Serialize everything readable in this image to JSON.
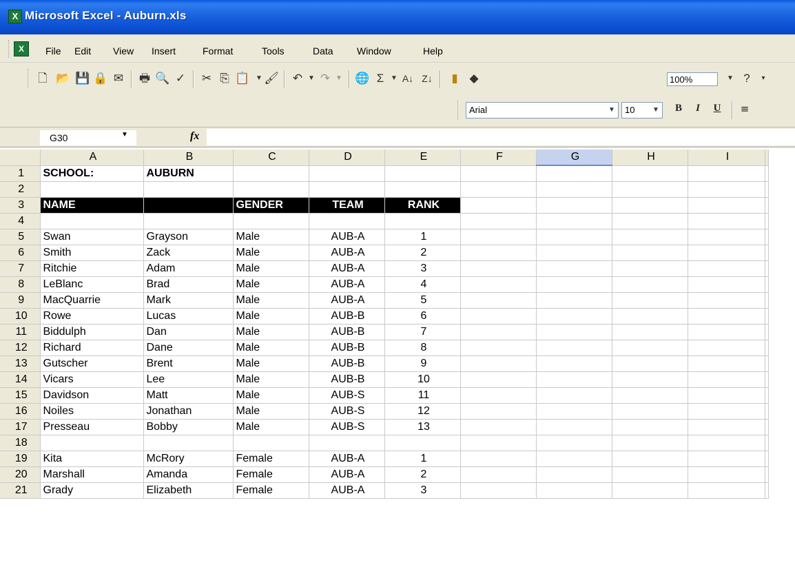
{
  "window": {
    "title": "Microsoft Excel - Auburn.xls",
    "app_icon": "excel-icon"
  },
  "menu": [
    "File",
    "Edit",
    "View",
    "Insert",
    "Format",
    "Tools",
    "Data",
    "Window",
    "Help"
  ],
  "toolbar": {
    "zoom": "100%",
    "font_name": "Arial",
    "font_size": "10",
    "bold": "B",
    "italic": "I",
    "underline": "U"
  },
  "formula_bar": {
    "name_box": "G30",
    "fx_label": "fx",
    "formula": ""
  },
  "sheet": {
    "columns": [
      "A",
      "B",
      "C",
      "D",
      "E",
      "F",
      "G",
      "H",
      "I"
    ],
    "selected_column": "G",
    "rows": [
      {
        "n": "1",
        "cells": [
          "SCHOOL:",
          "AUBURN",
          "",
          "",
          ""
        ]
      },
      {
        "n": "2",
        "cells": [
          "",
          "",
          "",
          "",
          ""
        ]
      },
      {
        "n": "3",
        "cells": [
          "NAME",
          "",
          "GENDER",
          "TEAM",
          "RANK"
        ]
      },
      {
        "n": "4",
        "cells": [
          "",
          "",
          "",
          "",
          ""
        ]
      },
      {
        "n": "5",
        "cells": [
          "Swan",
          "Grayson",
          "Male",
          "AUB-A",
          "1"
        ]
      },
      {
        "n": "6",
        "cells": [
          "Smith",
          "Zack",
          "Male",
          "AUB-A",
          "2"
        ]
      },
      {
        "n": "7",
        "cells": [
          "Ritchie",
          "Adam",
          "Male",
          "AUB-A",
          "3"
        ]
      },
      {
        "n": "8",
        "cells": [
          "LeBlanc",
          "Brad",
          "Male",
          "AUB-A",
          "4"
        ]
      },
      {
        "n": "9",
        "cells": [
          "MacQuarrie",
          "Mark",
          "Male",
          "AUB-A",
          "5"
        ]
      },
      {
        "n": "10",
        "cells": [
          "Rowe",
          "Lucas",
          "Male",
          "AUB-B",
          "6"
        ]
      },
      {
        "n": "11",
        "cells": [
          "Biddulph",
          "Dan",
          "Male",
          "AUB-B",
          "7"
        ]
      },
      {
        "n": "12",
        "cells": [
          "Richard",
          "Dane",
          "Male",
          "AUB-B",
          "8"
        ]
      },
      {
        "n": "13",
        "cells": [
          "Gutscher",
          "Brent",
          "Male",
          "AUB-B",
          "9"
        ]
      },
      {
        "n": "14",
        "cells": [
          "Vicars",
          "Lee",
          "Male",
          "AUB-B",
          "10"
        ]
      },
      {
        "n": "15",
        "cells": [
          "Davidson",
          "Matt",
          "Male",
          "AUB-S",
          "11"
        ]
      },
      {
        "n": "16",
        "cells": [
          "Noiles",
          "Jonathan",
          "Male",
          "AUB-S",
          "12"
        ]
      },
      {
        "n": "17",
        "cells": [
          "Presseau",
          "Bobby",
          "Male",
          "AUB-S",
          "13"
        ]
      },
      {
        "n": "18",
        "cells": [
          "",
          "",
          "",
          "",
          ""
        ]
      },
      {
        "n": "19",
        "cells": [
          "Kita",
          "McRory",
          "Female",
          "AUB-A",
          "1"
        ]
      },
      {
        "n": "20",
        "cells": [
          "Marshall",
          "Amanda",
          "Female",
          "AUB-A",
          "2"
        ]
      },
      {
        "n": "21",
        "cells": [
          "Grady",
          "Elizabeth",
          "Female",
          "AUB-A",
          "3"
        ]
      }
    ]
  }
}
